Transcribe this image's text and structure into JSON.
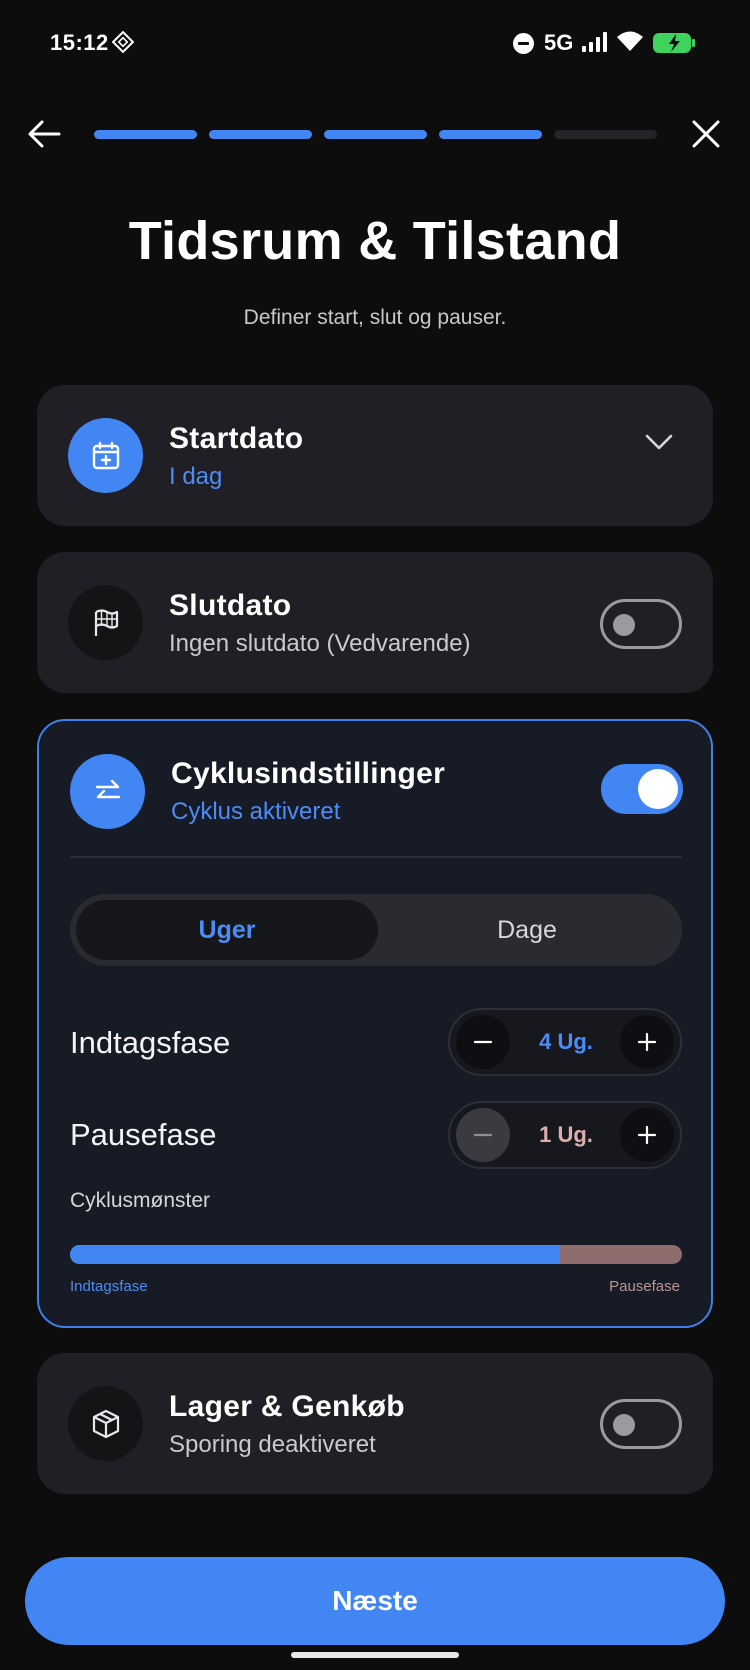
{
  "status_bar": {
    "time": "15:12",
    "network": "5G",
    "icons": [
      "nfc-icon",
      "dnd-icon",
      "signal-icon",
      "wifi-icon",
      "battery-charging-icon"
    ]
  },
  "progress": {
    "total_steps": 5,
    "completed_steps": 4
  },
  "header": {
    "title": "Tidsrum & Tilstand",
    "subtitle": "Definer start, slut og pauser."
  },
  "start_date": {
    "title": "Startdato",
    "value": "I dag",
    "icon": "calendar-plus-icon"
  },
  "end_date": {
    "title": "Slutdato",
    "value": "Ingen slutdato (Vedvarende)",
    "enabled": false,
    "icon": "flag-icon"
  },
  "cycle": {
    "title": "Cyklusindstillinger",
    "status": "Cyklus aktiveret",
    "enabled": true,
    "icon": "arrows-swap-icon",
    "units": [
      "Uger",
      "Dage"
    ],
    "selected_unit": "Uger",
    "intake_label": "Indtagsfase",
    "intake_value": "4 Ug.",
    "pause_label": "Pausefase",
    "pause_value": "1 Ug.",
    "pattern_label": "Cyklusmønster",
    "pattern_left": "Indtagsfase",
    "pattern_right": "Pausefase",
    "intake_fraction": 0.8
  },
  "inventory": {
    "title": "Lager & Genkøb",
    "status": "Sporing deaktiveret",
    "enabled": false,
    "icon": "box-icon"
  },
  "colors": {
    "accent": "#4286f4",
    "pause": "#8f6d6d",
    "background": "#0d0d0e",
    "card": "#1f1f25"
  },
  "next_button": {
    "label": "Næste"
  }
}
